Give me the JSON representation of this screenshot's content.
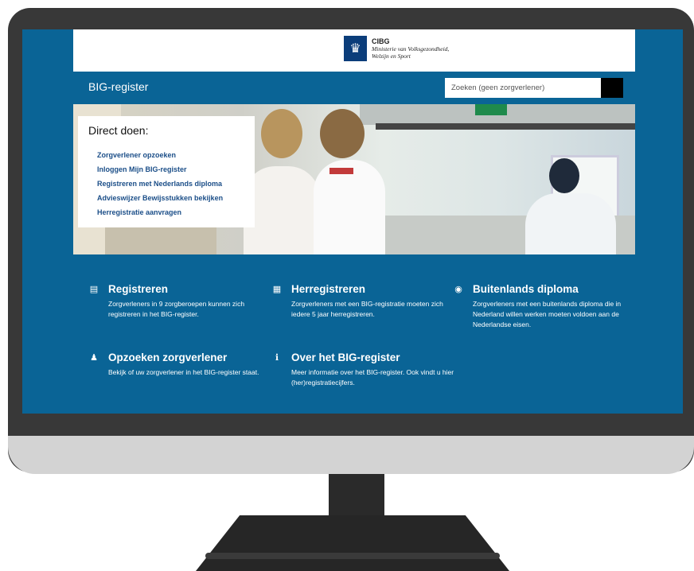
{
  "header": {
    "logo_org": "CIBG",
    "logo_ministry_line1": "Ministerie van Volksgezondheid,",
    "logo_ministry_line2": "Welzijn en Sport",
    "site_title": "BIG-register",
    "search_placeholder": "Zoeken (geen zorgverlener)"
  },
  "direct_doen": {
    "title": "Direct doen:",
    "links": [
      "Zorgverlener opzoeken",
      "Inloggen Mijn BIG-register",
      "Registreren met Nederlands diploma",
      "Advieswijzer Bewijsstukken bekijken",
      "Herregistratie aanvragen"
    ]
  },
  "features": [
    {
      "icon": "document-icon",
      "title": "Registreren",
      "desc": "Zorgverleners in 9 zorgberoepen kunnen zich registreren in het BIG-register."
    },
    {
      "icon": "clipboard-icon",
      "title": "Herregistreren",
      "desc": "Zorgverleners met een BIG-registratie moeten zich iedere 5 jaar herregistreren."
    },
    {
      "icon": "globe-icon",
      "title": "Buitenlands diploma",
      "desc": "Zorgverleners met een buitenlands diploma die in Nederland willen werken moeten voldoen aan de Nederlandse eisen."
    },
    {
      "icon": "person-search-icon",
      "title": "Opzoeken zorgverlener",
      "desc": "Bekijk of uw zorgverlener in het BIG-register staat."
    },
    {
      "icon": "info-icon",
      "title": "Over het BIG-register",
      "desc": "Meer informatie over het BIG-register. Ook vindt u hier (her)registratiecijfers."
    }
  ],
  "colors": {
    "screen_blue": "#0a6496",
    "link_blue": "#1b4e88",
    "logo_blue": "#0b3d7a"
  }
}
